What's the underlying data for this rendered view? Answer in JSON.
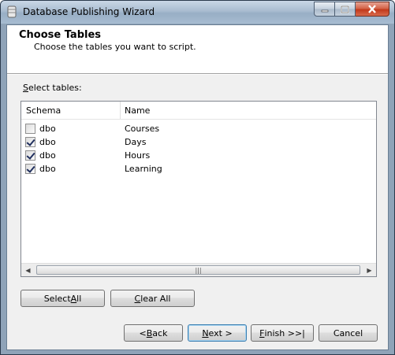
{
  "window": {
    "title": "Database Publishing Wizard",
    "icon": "database-icon",
    "caption_buttons": [
      "minimize-icon",
      "maximize-icon",
      "close-icon"
    ]
  },
  "header": {
    "title": "Choose Tables",
    "subtitle": "Choose the tables you want to script."
  },
  "tables_section": {
    "label": "Select tables:",
    "columns": [
      "Schema",
      "Name"
    ],
    "rows": [
      {
        "checked": false,
        "schema": "dbo",
        "name": "Courses"
      },
      {
        "checked": true,
        "schema": "dbo",
        "name": "Days"
      },
      {
        "checked": true,
        "schema": "dbo",
        "name": "Hours"
      },
      {
        "checked": true,
        "schema": "dbo",
        "name": "Learning"
      }
    ],
    "scroll_thumb_grip": "|||"
  },
  "actions": {
    "select_all": "Select All",
    "clear_all": "Clear All"
  },
  "nav": {
    "back": "< Back",
    "next": "Next >",
    "finish": "Finish >>|",
    "cancel": "Cancel"
  },
  "colors": {
    "title_bar": "#a9bcd0",
    "close_button": "#c2391b",
    "dialog_bg": "#f0f0f0",
    "default_button_border": "#3c7fb1"
  }
}
